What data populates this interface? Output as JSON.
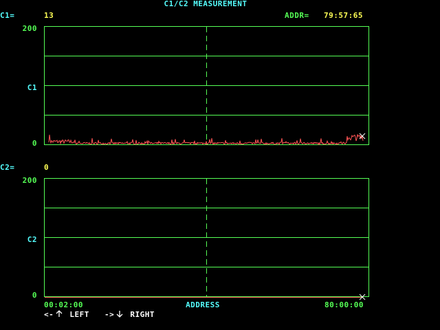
{
  "header": {
    "title": "C1/C2 MEASUREMENT",
    "c1_label": "C1=",
    "c1_value": "13",
    "addr_label": "ADDR=",
    "addr_value": "79:57:65"
  },
  "plot_c1": {
    "ymax_label": "200",
    "ymid_label": "C1",
    "ymin_label": "0"
  },
  "plot_c2": {
    "label": "C2=",
    "value": "0",
    "ymax_label": "200",
    "ymid_label": "C2",
    "ymin_label": "0"
  },
  "x_axis": {
    "start_label": "00:02:00",
    "label": "ADDRESS",
    "end_label": "80:00:00"
  },
  "nav": {
    "left_text": "<-",
    "left_label": "LEFT",
    "right_text": "->",
    "right_label": "RIGHT"
  },
  "colors": {
    "grid": "#55ff55",
    "trace": "#ff5555",
    "label": "#55ffff",
    "value": "#ffff55",
    "cursor": "#ffffff",
    "background": "#000000"
  },
  "icons": {
    "up_arrow": "up-arrow-icon",
    "down_arrow": "down-arrow-icon",
    "cursor": "x-cursor-icon"
  }
}
